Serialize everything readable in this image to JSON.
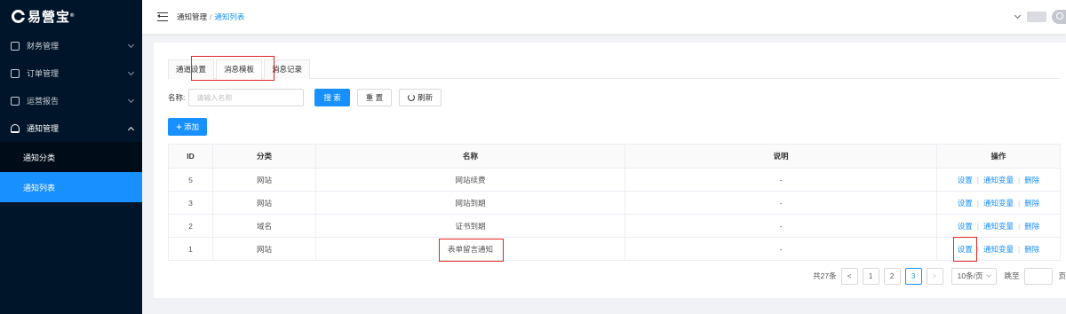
{
  "brand": {
    "name": "易營宝",
    "mark": "®"
  },
  "sidebar": {
    "items": [
      {
        "label": "财务管理",
        "icon": "finance-icon"
      },
      {
        "label": "订单管理",
        "icon": "order-icon"
      },
      {
        "label": "运营报告",
        "icon": "report-icon"
      },
      {
        "label": "通知管理",
        "icon": "bell-icon"
      }
    ],
    "submenu": [
      {
        "label": "通知分类"
      },
      {
        "label": "通知列表"
      }
    ]
  },
  "header": {
    "breadcrumb_parent": "通知管理",
    "breadcrumb_sep": "/",
    "breadcrumb_current": "通知列表"
  },
  "tabs": [
    "通道设置",
    "消息模板",
    "消息记录"
  ],
  "active_tab": 1,
  "search": {
    "label": "名称:",
    "placeholder": "请输入名称",
    "search_btn": "搜 索",
    "reset_btn": "重 置",
    "refresh_btn": "刷新"
  },
  "add_button": {
    "plus": "+",
    "label": "添加"
  },
  "table": {
    "columns": [
      "ID",
      "分类",
      "名称",
      "说明",
      "操作"
    ],
    "rows": [
      {
        "id": "5",
        "category": "网站",
        "name": "网站续费",
        "desc": "-"
      },
      {
        "id": "3",
        "category": "网站",
        "name": "网站到期",
        "desc": "-"
      },
      {
        "id": "2",
        "category": "域名",
        "name": "证书到期",
        "desc": "-"
      },
      {
        "id": "1",
        "category": "网站",
        "name": "表单留言通知",
        "desc": "-"
      }
    ],
    "actions": {
      "set": "设置",
      "vars": "通知变量",
      "del": "删除",
      "sep": "|"
    }
  },
  "pagination": {
    "total_text": "共27条",
    "prev": "<",
    "pages": [
      "1",
      "2",
      "3"
    ],
    "current_page": "3",
    "next": ">",
    "page_size": "10条/页",
    "jump_label": "跳至",
    "page_unit": "页"
  },
  "colors": {
    "sidebar": "#001529",
    "primary": "#1890ff",
    "highlight": "#e02424"
  }
}
